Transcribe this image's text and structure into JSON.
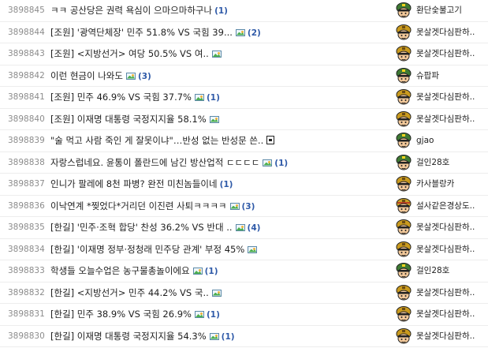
{
  "posts": [
    {
      "num": "3898845",
      "title": "ㅋㅋ 공산당은 권력 욕심이 으마으마하구나",
      "attach": "",
      "comments": "(1)",
      "nick": "환단숯불고기",
      "avatar": "soldier-green"
    },
    {
      "num": "3898844",
      "title": "[조원] '광역단체장' 민주 51.8% VS 국힘 39...",
      "attach": "image",
      "comments": "(2)",
      "nick": "못살겟다심판하..",
      "avatar": "soldier-yellow"
    },
    {
      "num": "3898843",
      "title": "[조원] <지방선거> 여당 50.5% VS 여..",
      "attach": "image",
      "comments": "",
      "nick": "못살겟다심판하..",
      "avatar": "soldier-yellow"
    },
    {
      "num": "3898842",
      "title": "이런 현금이 나와도",
      "attach": "image",
      "comments": "(3)",
      "nick": "슈팝파",
      "avatar": "soldier-green"
    },
    {
      "num": "3898841",
      "title": "[조원] 민주 46.9% VS 국힘 37.7%",
      "attach": "image",
      "comments": "(1)",
      "nick": "못살겟다심판하..",
      "avatar": "soldier-yellow"
    },
    {
      "num": "3898840",
      "title": "[조원] 이재명 대통령 국정지지율 58.1%",
      "attach": "image",
      "comments": "",
      "nick": "못살겟다심판하..",
      "avatar": "soldier-yellow"
    },
    {
      "num": "3898839",
      "title": "\"술 먹고 사람 죽인 게 잘못이냐\"…반성 없는 반성문 쓴..",
      "attach": "video",
      "comments": "",
      "nick": "gjao",
      "avatar": "soldier-green"
    },
    {
      "num": "3898838",
      "title": "자랑스럽네요. 윤통이 폴란드에 남긴 방산업적 ㄷㄷㄷㄷ",
      "attach": "image",
      "comments": "(1)",
      "nick": "걸인28호",
      "avatar": "soldier-green"
    },
    {
      "num": "3898837",
      "title": "인니가 팔레에 8천 파병? 완전 미친놈들이네",
      "attach": "",
      "comments": "(1)",
      "nick": "카사블랑카",
      "avatar": "soldier-yellow"
    },
    {
      "num": "3898836",
      "title": "이낙연계 *찢었다*거리던 이진련 사퇴ㅋㅋㅋㅋ",
      "attach": "image",
      "comments": "(3)",
      "nick": "설사같은경상도..",
      "avatar": "soldier-striped"
    },
    {
      "num": "3898835",
      "title": "[한길] '민주·조혁 합당' 찬성 36.2% VS 반대 ..",
      "attach": "image",
      "comments": "(4)",
      "nick": "못살겟다심판하..",
      "avatar": "soldier-yellow"
    },
    {
      "num": "3898834",
      "title": "[한길] '이재명 정부·정청래 민주당 관계' 부정 45%",
      "attach": "image",
      "comments": "",
      "nick": "못살겟다심판하..",
      "avatar": "soldier-yellow"
    },
    {
      "num": "3898833",
      "title": "학생들 오늘수업은 농구물총놀이에요",
      "attach": "image",
      "comments": "(1)",
      "nick": "걸인28호",
      "avatar": "soldier-green"
    },
    {
      "num": "3898832",
      "title": "[한길] <지방선거> 민주 44.2% VS 국..",
      "attach": "image",
      "comments": "",
      "nick": "못살겟다심판하..",
      "avatar": "soldier-yellow"
    },
    {
      "num": "3898831",
      "title": "[한길] 민주 38.9% VS 국힘 26.9%",
      "attach": "image",
      "comments": "(1)",
      "nick": "못살겟다심판하..",
      "avatar": "soldier-yellow"
    },
    {
      "num": "3898830",
      "title": "[한길] 이재명 대통령 국정지지율 54.3%",
      "attach": "image",
      "comments": "(1)",
      "nick": "못살겟다심판하..",
      "avatar": "soldier-yellow"
    }
  ]
}
